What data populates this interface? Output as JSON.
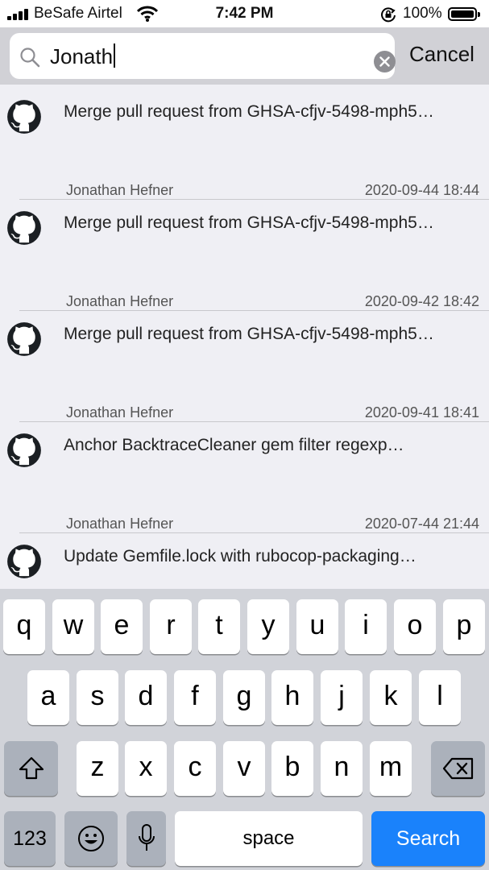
{
  "status_bar": {
    "carrier": "BeSafe Airtel",
    "time": "7:42 PM",
    "battery_percent": "100%"
  },
  "search": {
    "value": "Jonath",
    "cancel_label": "Cancel"
  },
  "results": [
    {
      "title": "Merge pull request from GHSA-cfjv-5498-mph5…",
      "author": "Jonathan Hefner",
      "date": "2020-09-44 18:44"
    },
    {
      "title": "Merge pull request from GHSA-cfjv-5498-mph5…",
      "author": "Jonathan Hefner",
      "date": "2020-09-42 18:42"
    },
    {
      "title": "Merge pull request from GHSA-cfjv-5498-mph5…",
      "author": "Jonathan Hefner",
      "date": "2020-09-41 18:41"
    },
    {
      "title": "Anchor BacktraceCleaner gem filter regexp…",
      "author": "Jonathan Hefner",
      "date": "2020-07-44 21:44"
    },
    {
      "title": "Update Gemfile.lock with rubocop-packaging…",
      "author": "",
      "date": ""
    }
  ],
  "keyboard": {
    "row1": [
      "q",
      "w",
      "e",
      "r",
      "t",
      "y",
      "u",
      "i",
      "o",
      "p"
    ],
    "row2": [
      "a",
      "s",
      "d",
      "f",
      "g",
      "h",
      "j",
      "k",
      "l"
    ],
    "row3": [
      "z",
      "x",
      "c",
      "v",
      "b",
      "n",
      "m"
    ],
    "numbers_label": "123",
    "space_label": "space",
    "search_label": "Search"
  },
  "colors": {
    "search_key": "#1a82fb",
    "background": "#efeff4"
  }
}
